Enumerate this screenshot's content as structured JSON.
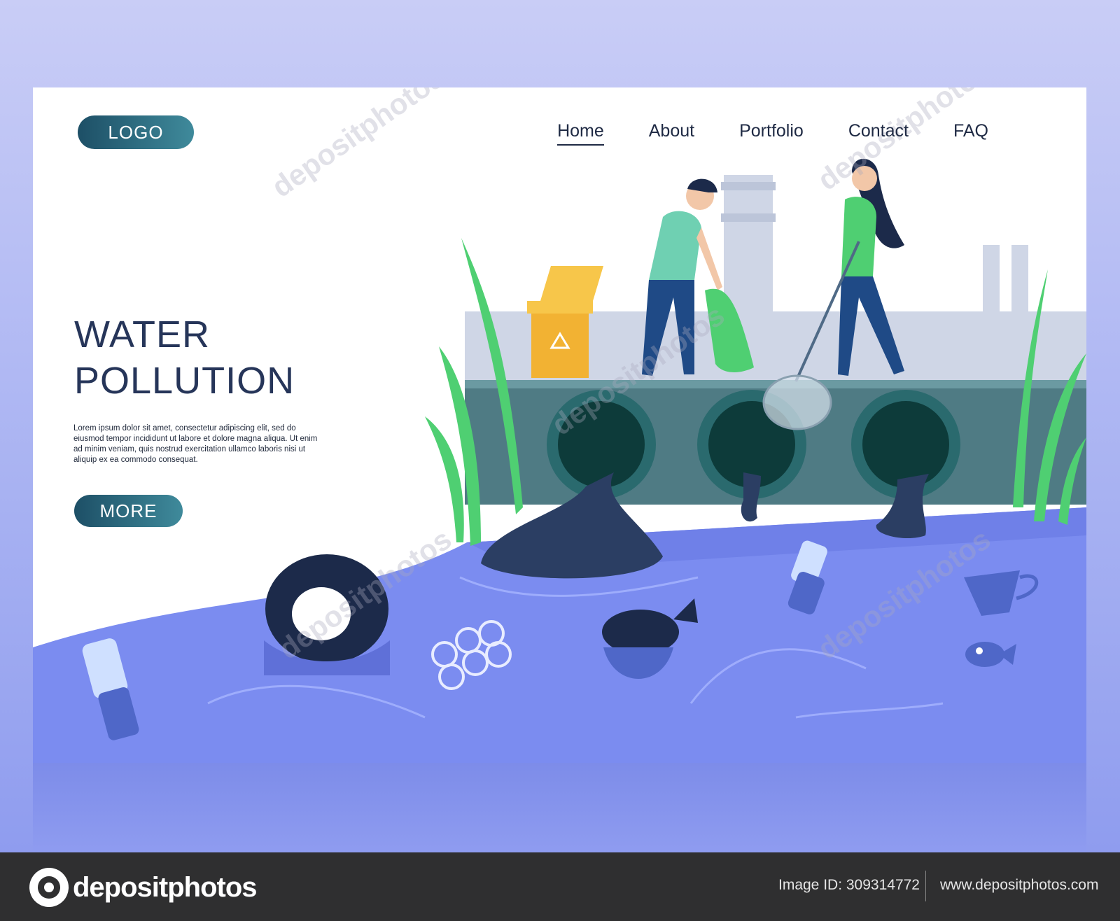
{
  "header": {
    "logo_label": "LOGO",
    "nav": [
      {
        "label": "Home",
        "active": true
      },
      {
        "label": "About",
        "active": false
      },
      {
        "label": "Portfolio",
        "active": false
      },
      {
        "label": "Contact",
        "active": false
      },
      {
        "label": "FAQ",
        "active": false
      }
    ]
  },
  "hero": {
    "headline_line1": "WATER",
    "headline_line2": "POLLUTION",
    "body": "Lorem ipsum dolor sit amet, consectetur adipiscing elit, sed do eiusmod tempor incididunt ut labore et dolore magna aliqua. Ut enim ad minim veniam, quis nostrud exercitation ullamco laboris nisi ut aliquip ex ea commodo consequat.",
    "more_label": "MORE"
  },
  "watermark": "depositphotos",
  "footer": {
    "brand": "depositphotos",
    "image_id": "Image ID: 309314772",
    "url": "www.depositphotos.com"
  },
  "colors": {
    "accent_button": "#1d4f66",
    "headline": "#263559",
    "water": "#7b8cf0",
    "grass": "#4fcf72",
    "footer_bg": "#2f2f30"
  }
}
